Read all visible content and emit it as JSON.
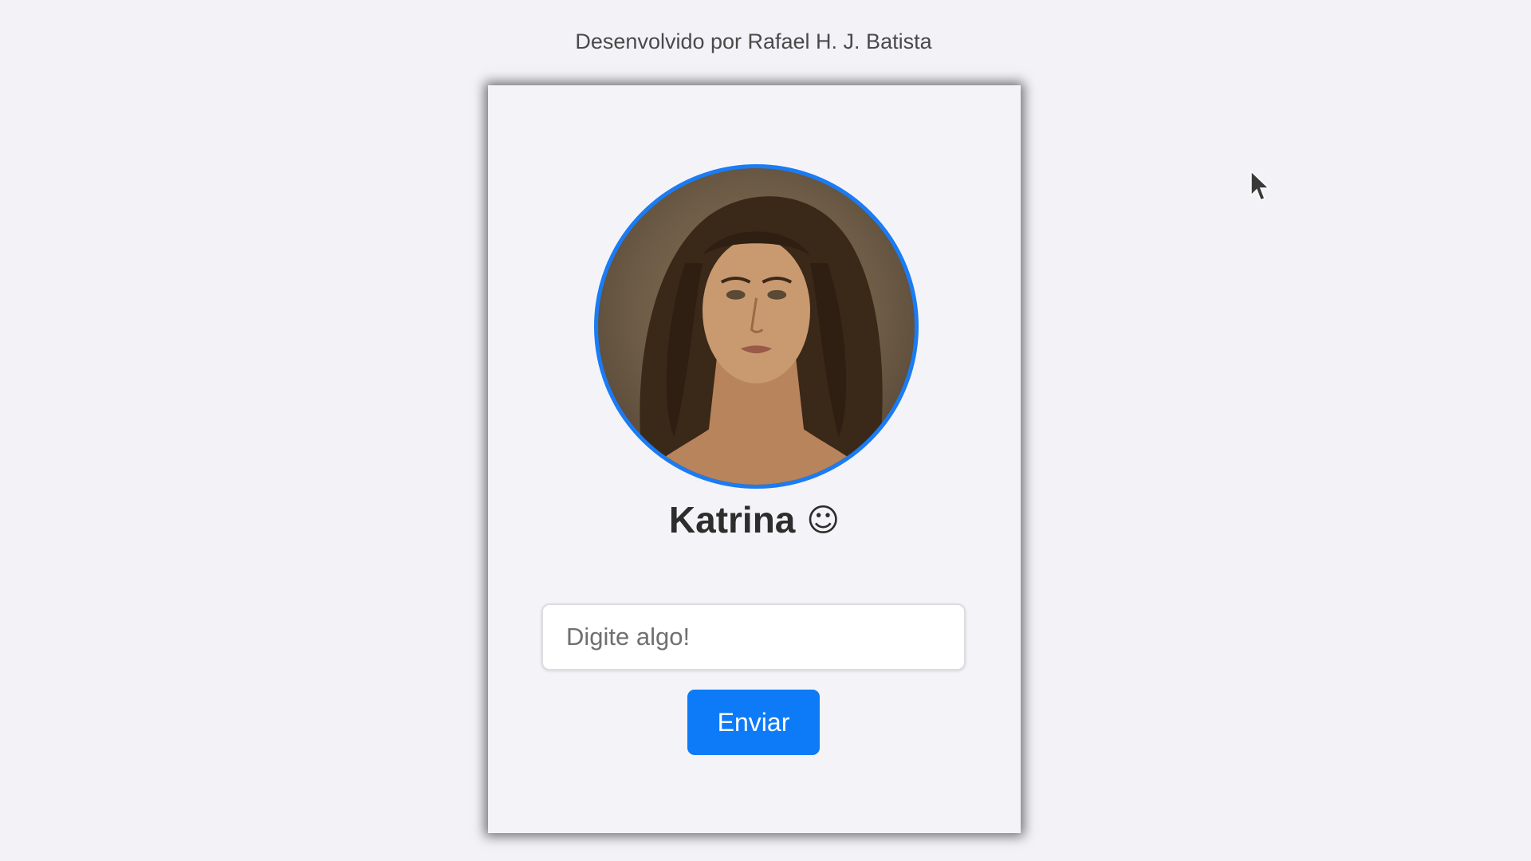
{
  "credit": "Desenvolvido por Rafael H. J. Batista",
  "profile": {
    "name": "Katrina",
    "emoji": "☺"
  },
  "input": {
    "placeholder": "Digite algo!",
    "value": ""
  },
  "button": {
    "label": "Enviar"
  },
  "colors": {
    "accent": "#0d7bf7",
    "background": "#f3f3f7"
  },
  "icons": {
    "avatar": "avatar-photo",
    "cursor": "mouse-pointer-icon"
  }
}
